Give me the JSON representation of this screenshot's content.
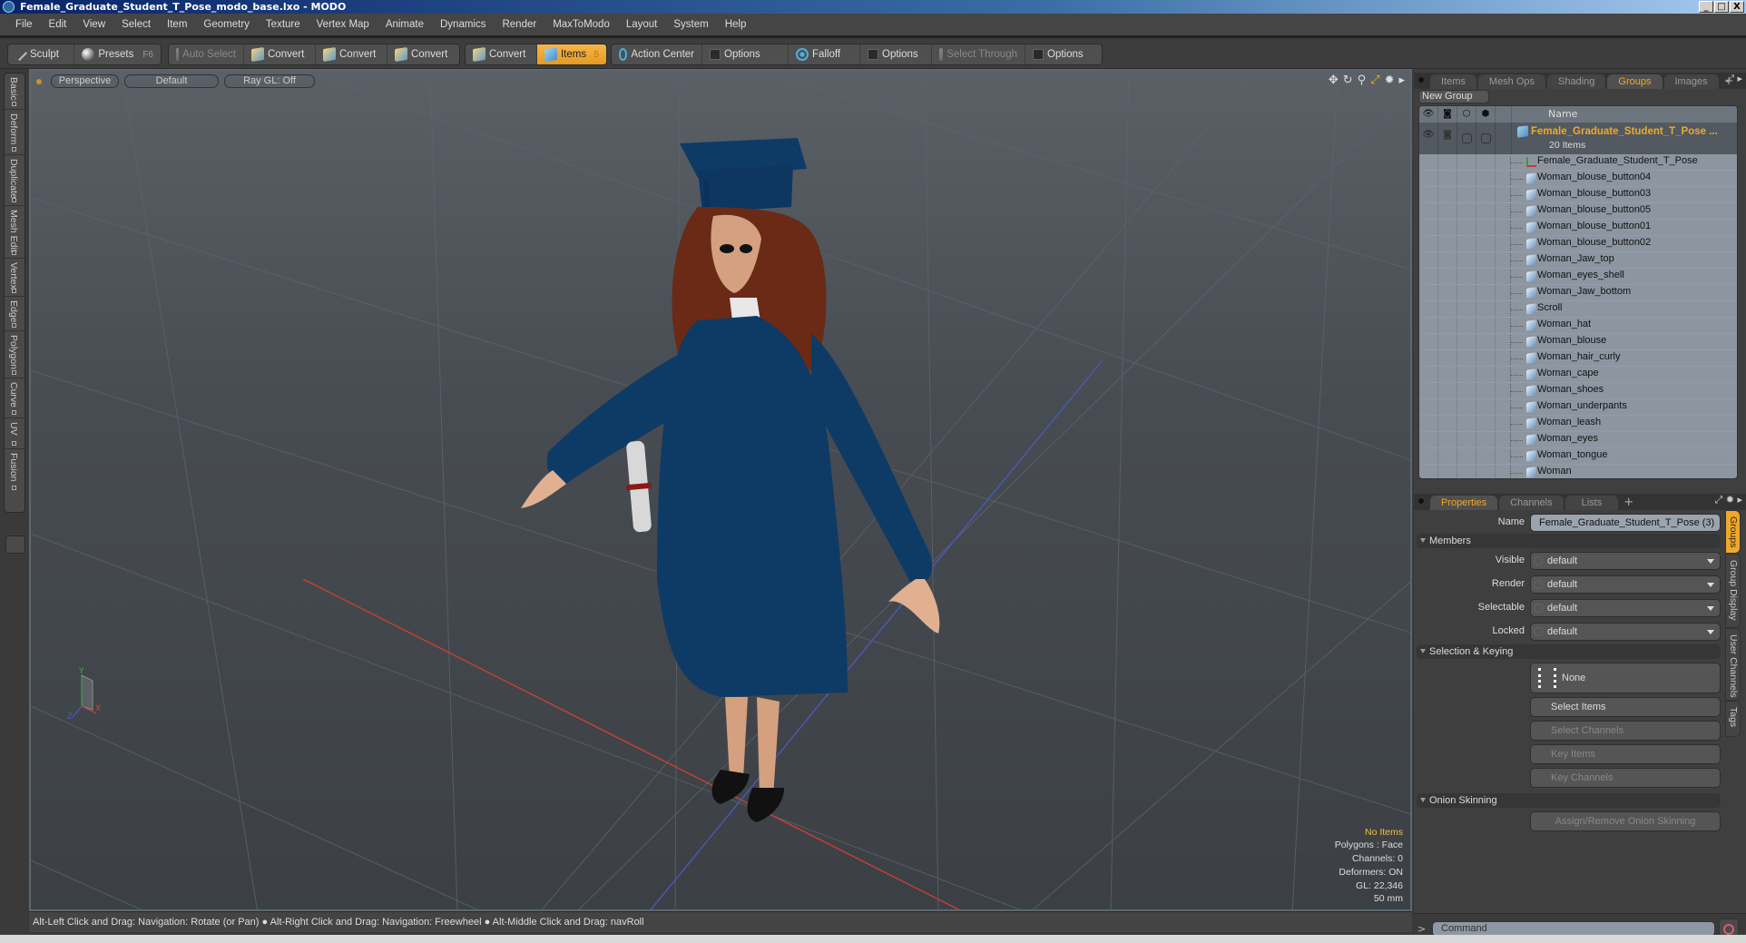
{
  "window": {
    "title": "Female_Graduate_Student_T_Pose_modo_base.lxo - MODO"
  },
  "menu": [
    "File",
    "Edit",
    "View",
    "Select",
    "Item",
    "Geometry",
    "Texture",
    "Vertex Map",
    "Animate",
    "Dynamics",
    "Render",
    "MaxToModo",
    "Layout",
    "System",
    "Help"
  ],
  "toolbar": {
    "sculpt": "Sculpt",
    "presets": "Presets",
    "presets_shortcut": "F6",
    "auto_select": "Auto Select",
    "convert1": "Convert",
    "convert2": "Convert",
    "convert3": "Convert",
    "convert4": "Convert",
    "items": "Items",
    "items_shortcut": "5",
    "action_center": "Action Center",
    "options1": "Options",
    "falloff": "Falloff",
    "options2": "Options",
    "select_through": "Select Through",
    "options3": "Options"
  },
  "left_tabs": [
    "Basic",
    "Deform",
    "Duplicate",
    "Mesh Edit",
    "Vertex",
    "Edge",
    "Polygon",
    "Curve",
    "UV",
    "Fusion"
  ],
  "viewport": {
    "view_mode": "Perspective",
    "shading": "Default",
    "raygl": "Ray GL: Off",
    "info": {
      "selection": "No Items",
      "polygons": "Polygons : Face",
      "channels": "Channels: 0",
      "deformers": "Deformers: ON",
      "gl": "GL: 22,346",
      "focal": "50 mm"
    },
    "axis_labels": {
      "x": "X",
      "y": "Y",
      "z": "Z"
    }
  },
  "status_bar": "Alt-Left Click and Drag: Navigation: Rotate (or Pan) ● Alt-Right Click and Drag: Navigation: Freewheel ● Alt-Middle Click and Drag: navRoll",
  "right_panel": {
    "top_tabs": [
      "Items",
      "Mesh Ops",
      "Shading",
      "Groups",
      "Images"
    ],
    "top_active": "Groups",
    "new_group": "New Group",
    "tree_header_name": "Name",
    "group": {
      "name": "Female_Graduate_Student_T_Pose ...",
      "count": "20 Items"
    },
    "items": [
      {
        "name": "Female_Graduate_Student_T_Pose",
        "type": "locator"
      },
      {
        "name": "Woman_blouse_button04",
        "type": "mesh"
      },
      {
        "name": "Woman_blouse_button03",
        "type": "mesh"
      },
      {
        "name": "Woman_blouse_button05",
        "type": "mesh"
      },
      {
        "name": "Woman_blouse_button01",
        "type": "mesh"
      },
      {
        "name": "Woman_blouse_button02",
        "type": "mesh"
      },
      {
        "name": "Woman_Jaw_top",
        "type": "mesh"
      },
      {
        "name": "Woman_eyes_shell",
        "type": "mesh"
      },
      {
        "name": "Woman_Jaw_bottom",
        "type": "mesh"
      },
      {
        "name": "Scroll",
        "type": "mesh"
      },
      {
        "name": "Woman_hat",
        "type": "mesh"
      },
      {
        "name": "Woman_blouse",
        "type": "mesh"
      },
      {
        "name": "Woman_hair_curly",
        "type": "mesh"
      },
      {
        "name": "Woman_cape",
        "type": "mesh"
      },
      {
        "name": "Woman_shoes",
        "type": "mesh"
      },
      {
        "name": "Woman_underpants",
        "type": "mesh"
      },
      {
        "name": "Woman_leash",
        "type": "mesh"
      },
      {
        "name": "Woman_eyes",
        "type": "mesh"
      },
      {
        "name": "Woman_tongue",
        "type": "mesh"
      },
      {
        "name": "Woman",
        "type": "mesh"
      }
    ],
    "prop_tabs": [
      "Properties",
      "Channels",
      "Lists"
    ],
    "prop_active": "Properties",
    "properties": {
      "name_label": "Name",
      "name_value": "Female_Graduate_Student_T_Pose (3)",
      "members_section": "Members",
      "visible_label": "Visible",
      "visible_value": "default",
      "render_label": "Render",
      "render_value": "default",
      "selectable_label": "Selectable",
      "selectable_value": "default",
      "locked_label": "Locked",
      "locked_value": "default",
      "selection_section": "Selection & Keying",
      "hierarchy_value": "None",
      "select_items": "Select Items",
      "select_channels": "Select Channels",
      "key_items": "Key Items",
      "key_channels": "Key Channels",
      "onion_section": "Onion Skinning",
      "onion_button": "Assign/Remove Onion Skinning"
    },
    "side_tabs": [
      "Groups",
      "Group Display",
      "User Channels",
      "Tags"
    ],
    "command_placeholder": "Command",
    "command_prompt": ">"
  },
  "colors": {
    "accent": "#f0a82a",
    "gown": "#0e3a66",
    "hair": "#6a2a16",
    "grid_x": "#d04030",
    "grid_z": "#4a5ac0"
  }
}
